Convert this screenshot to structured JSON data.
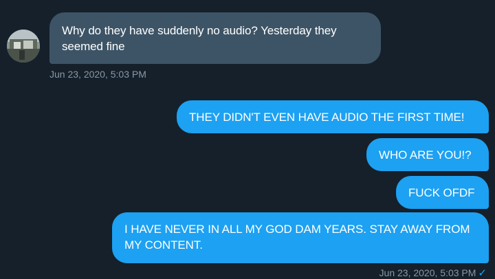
{
  "conversation": {
    "received": {
      "text": "Why do they have suddenly no audio? Yesterday they seemed fine",
      "timestamp": "Jun 23, 2020, 5:03 PM"
    },
    "sent": [
      {
        "text": "THEY DIDN'T EVEN HAVE AUDIO THE FIRST TIME!"
      },
      {
        "text": "WHO ARE YOU!?"
      },
      {
        "text": "FUCK OFDF"
      },
      {
        "text": "I HAVE NEVER IN ALL MY GOD DAM YEARS. STAY AWAY FROM MY CONTENT."
      }
    ],
    "sent_timestamp": "Jun 23, 2020, 5:03 PM",
    "read_icon": "checkmark-icon"
  },
  "colors": {
    "background": "#15202b",
    "received_bubble": "#3d5466",
    "sent_bubble": "#1da1f2",
    "timestamp": "#8899a6"
  }
}
